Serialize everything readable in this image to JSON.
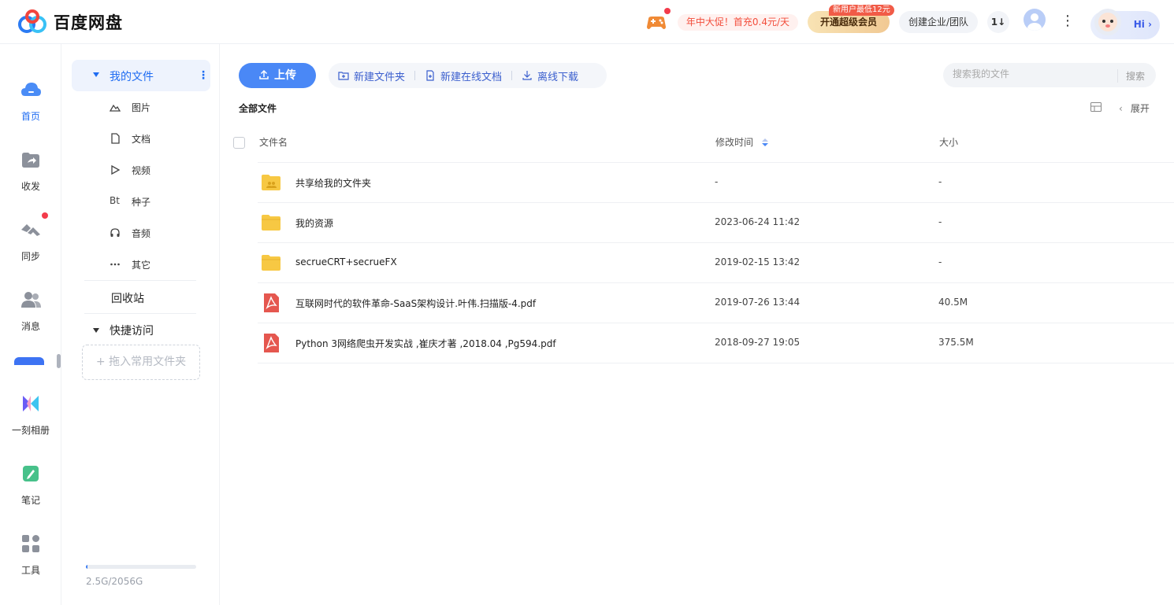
{
  "app": {
    "title": "百度网盘"
  },
  "header": {
    "promo": "年中大促！首充0.4元/天",
    "vip_label": "开通超级会员",
    "vip_badge": "新用户最低12元",
    "team_label": "创建企业/团队",
    "sort_label": "1↓",
    "hi_label": "Hi ›"
  },
  "rail": {
    "items": [
      {
        "label": "首页",
        "icon": "cloud-home-icon",
        "active": true
      },
      {
        "label": "收发",
        "icon": "share-folder-icon"
      },
      {
        "label": "同步",
        "icon": "sync-icon"
      },
      {
        "label": "消息",
        "icon": "contacts-icon"
      },
      {
        "label": "一刻相册",
        "icon": "album-icon"
      },
      {
        "label": "笔记",
        "icon": "note-icon"
      },
      {
        "label": "工具",
        "icon": "tools-icon"
      }
    ]
  },
  "tree": {
    "mine": "我的文件",
    "categories": [
      {
        "label": "图片",
        "icon": "image-icon"
      },
      {
        "label": "文档",
        "icon": "document-icon"
      },
      {
        "label": "视频",
        "icon": "video-icon"
      },
      {
        "label": "种子",
        "icon": "torrent-icon"
      },
      {
        "label": "音频",
        "icon": "audio-icon"
      },
      {
        "label": "其它",
        "icon": "other-icon"
      }
    ],
    "torrent_glyph": "Bt",
    "recycle": "回收站",
    "quick_access": "快捷访问",
    "drop_hint": "+ 拖入常用文件夹",
    "storage_text": "2.5G/2056G",
    "storage_used_fraction": 0.0012
  },
  "toolbar": {
    "upload": "上传",
    "new_folder": "新建文件夹",
    "new_doc": "新建在线文档",
    "offline_download": "离线下载"
  },
  "search": {
    "placeholder": "搜索我的文件",
    "button": "搜索"
  },
  "main": {
    "breadcrumb": "全部文件",
    "expand": "展开",
    "columns": {
      "name": "文件名",
      "modified": "修改时间",
      "size": "大小"
    },
    "files": [
      {
        "name": "共享给我的文件夹",
        "modified": "-",
        "size": "-",
        "type": "shared-folder"
      },
      {
        "name": "我的资源",
        "modified": "2023-06-24 11:42",
        "size": "-",
        "type": "folder"
      },
      {
        "name": "secrueCRT+secrueFX",
        "modified": "2019-02-15 13:42",
        "size": "-",
        "type": "folder"
      },
      {
        "name": "互联网时代的软件革命-SaaS架构设计.叶伟.扫描版-4.pdf",
        "modified": "2019-07-26 13:44",
        "size": "40.5M",
        "type": "pdf"
      },
      {
        "name": "Python 3网络爬虫开发实战 ,崔庆才著 ,2018.04 ,Pg594.pdf",
        "modified": "2018-09-27 19:05",
        "size": "375.5M",
        "type": "pdf"
      }
    ]
  },
  "colors": {
    "accent": "#4a88f6",
    "folder": "#f7c843",
    "pdf": "#e5574f"
  }
}
